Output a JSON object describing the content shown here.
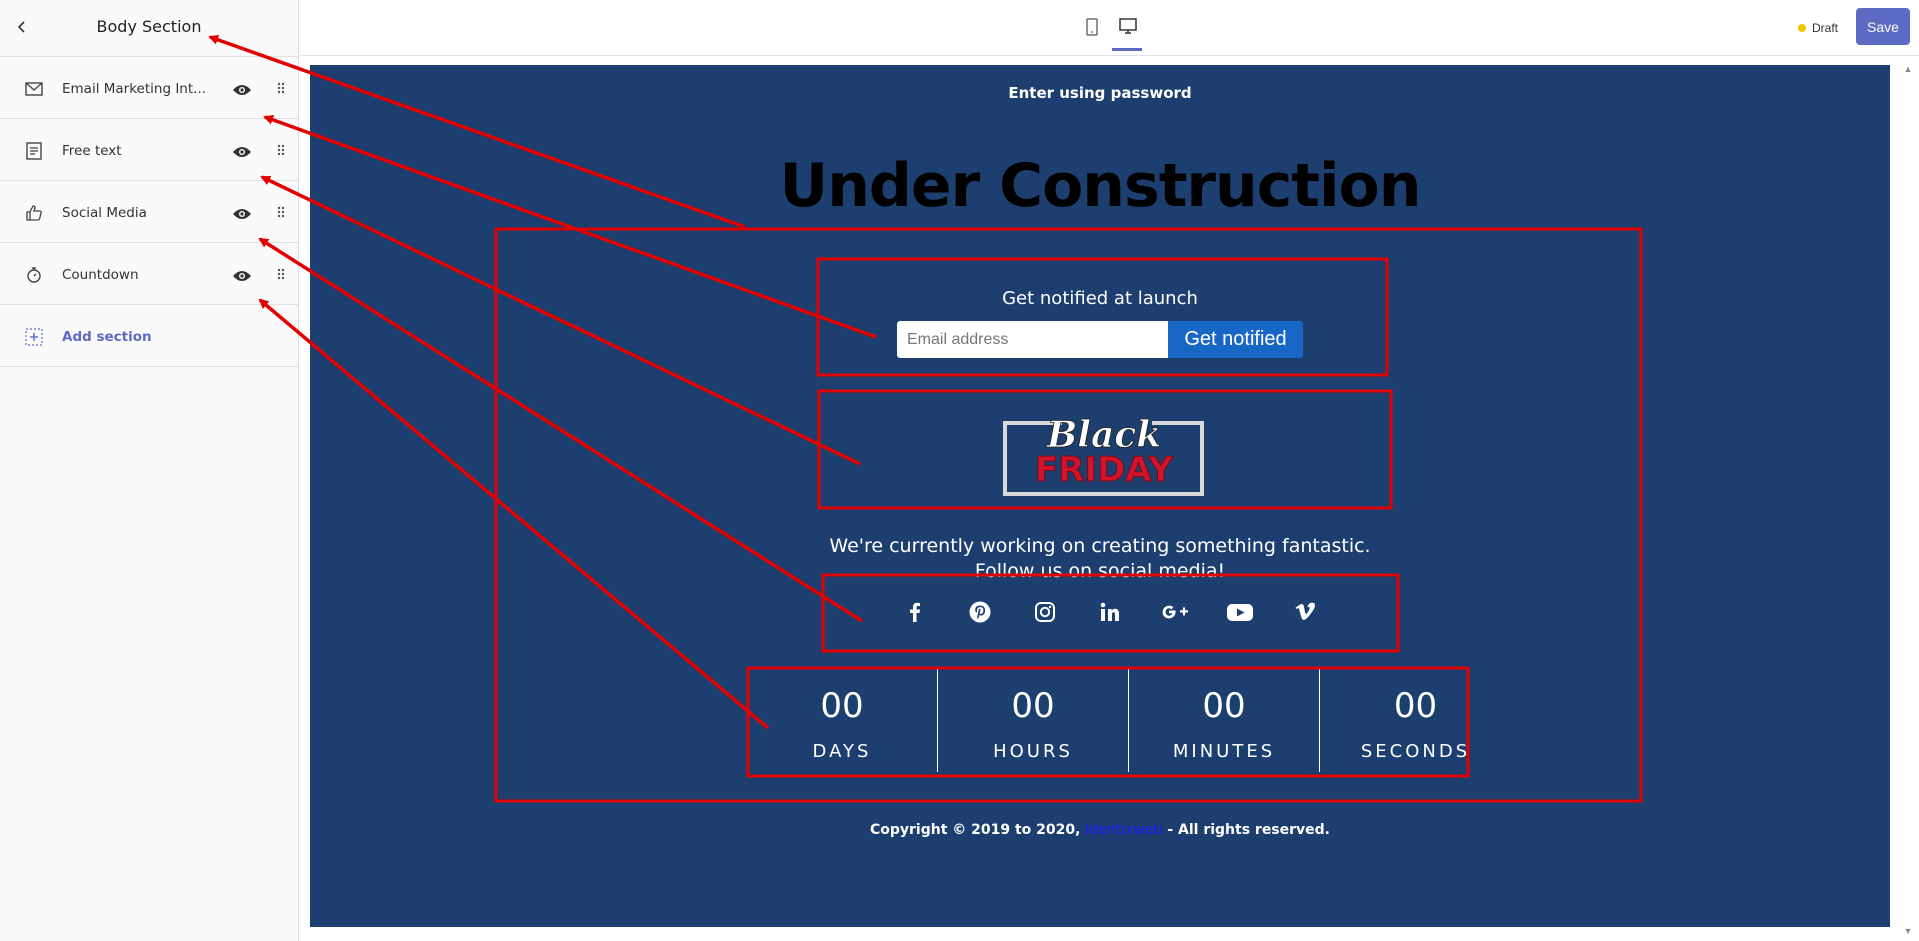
{
  "sidebar": {
    "title": "Body Section",
    "items": [
      {
        "label": "Email Marketing Int...",
        "icon": "mail-icon"
      },
      {
        "label": "Free text",
        "icon": "text-icon"
      },
      {
        "label": "Social Media",
        "icon": "thumbs-up-icon"
      },
      {
        "label": "Countdown",
        "icon": "stopwatch-icon"
      }
    ],
    "add_label": "Add section"
  },
  "topbar": {
    "status": "Draft",
    "save_label": "Save",
    "accent_color": "#5c6ac4"
  },
  "page": {
    "enter_password": "Enter using password",
    "title": "Under Construction",
    "notify_title": "Get notified at launch",
    "email_placeholder": "Email address",
    "notify_button": "Get notified",
    "logo_text_1": "Black",
    "logo_text_2": "FRIDAY",
    "message_line1": "We're currently working on creating something fantastic.",
    "message_line2": "Follow us on social media!",
    "social": [
      "facebook-icon",
      "pinterest-icon",
      "instagram-icon",
      "linkedin-icon",
      "google-plus-icon",
      "youtube-icon",
      "vimeo-icon"
    ],
    "countdown": [
      {
        "value": "00",
        "label": "DAYS"
      },
      {
        "value": "00",
        "label": "HOURS"
      },
      {
        "value": "00",
        "label": "MINUTES"
      },
      {
        "value": "00",
        "label": "SECONDS"
      }
    ],
    "copyright_prefix": "Copyright © 2019 to 2020, ",
    "copyright_link": "Identixweb",
    "copyright_suffix": " - All rights reserved.",
    "background_color": "#1c3f6f"
  }
}
